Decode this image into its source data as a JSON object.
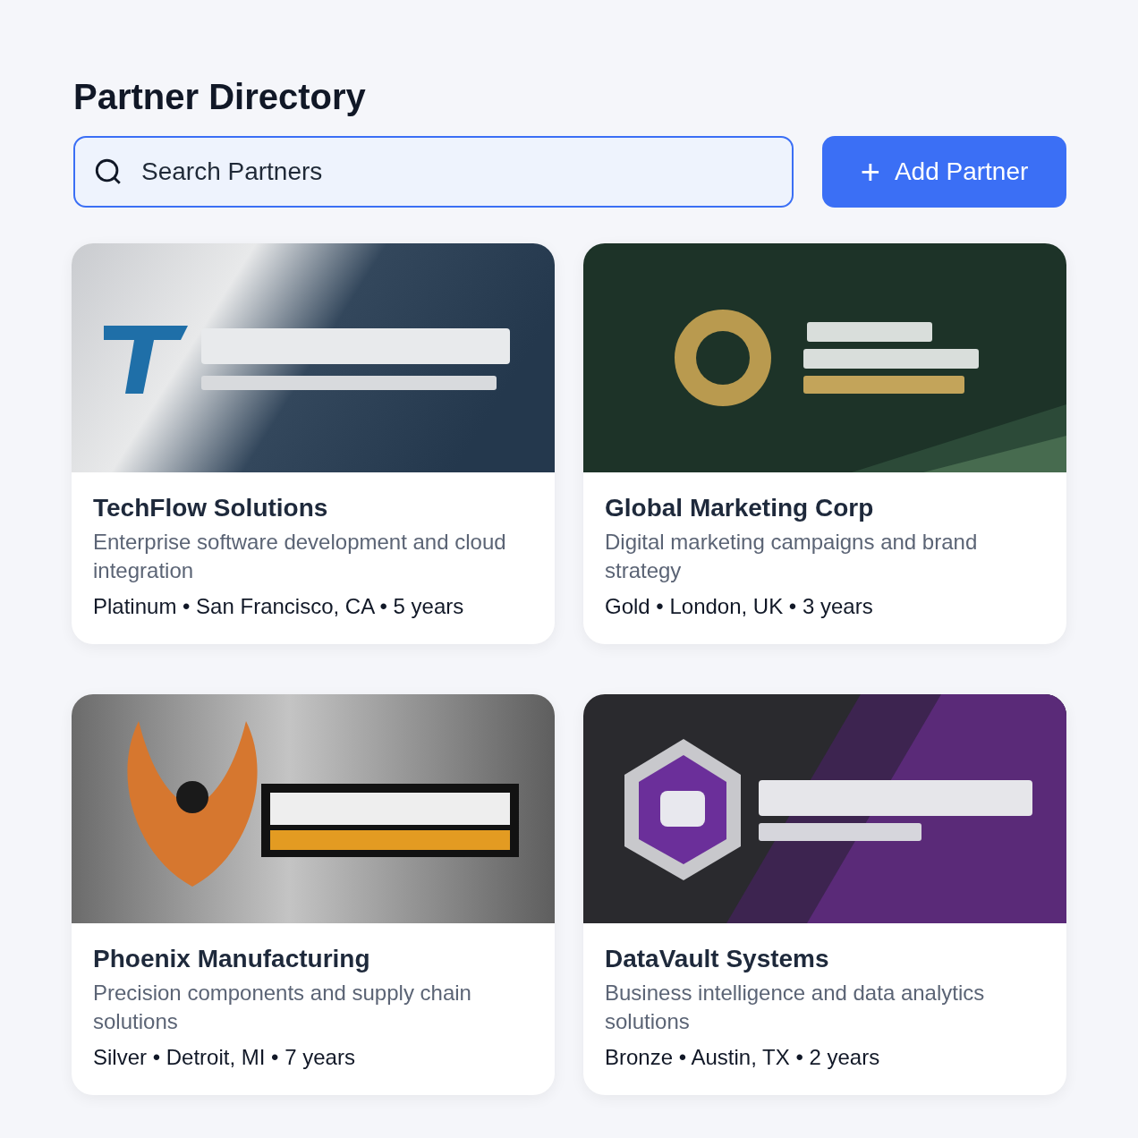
{
  "title": "Partner Directory",
  "search": {
    "placeholder": "Search Partners"
  },
  "add_button": {
    "icon": "+",
    "label": "Add Partner"
  },
  "partners": [
    {
      "name": "TechFlow Solutions",
      "description": "Enterprise software development and cloud integration",
      "meta": "Platinum • San Francisco, CA • 5 years"
    },
    {
      "name": "Global Marketing Corp",
      "description": "Digital marketing campaigns and brand strategy",
      "meta": "Gold • London, UK • 3 years"
    },
    {
      "name": "Phoenix Manufacturing",
      "description": "Precision components and supply chain solutions",
      "meta": "Silver • Detroit, MI • 7 years"
    },
    {
      "name": "DataVault Systems",
      "description": "Business intelligence and data analytics solutions",
      "meta": "Bronze • Austin, TX • 2 years"
    }
  ]
}
